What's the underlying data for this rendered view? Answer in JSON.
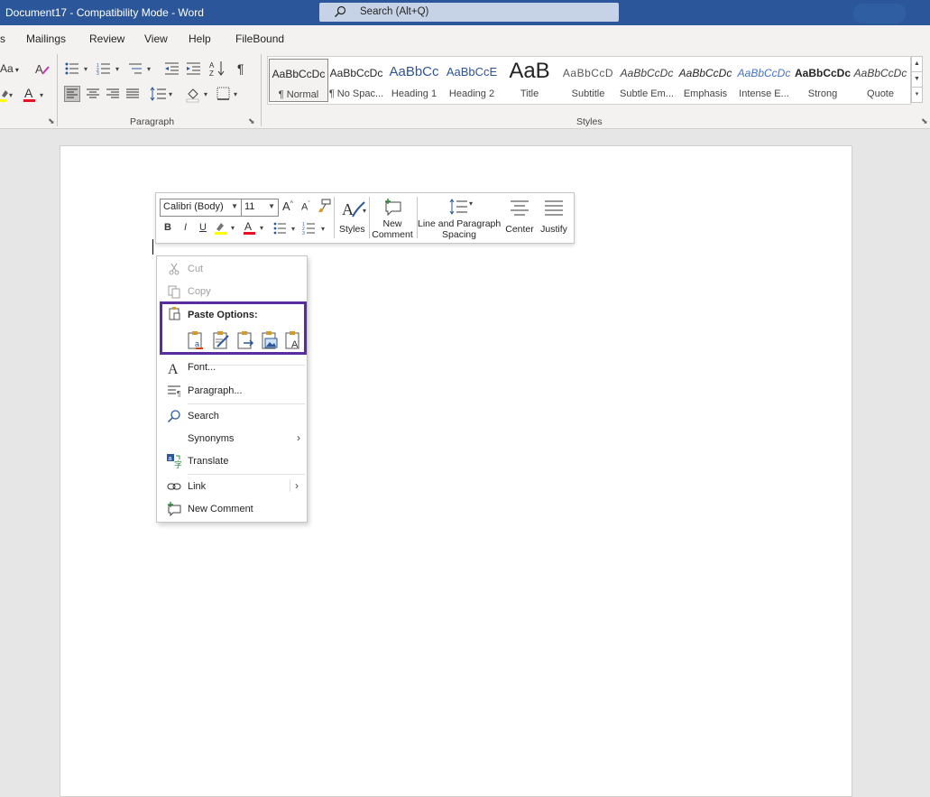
{
  "window": {
    "title": "Document17  -  Compatibility Mode  -  Word",
    "search_placeholder": "Search (Alt+Q)"
  },
  "tabs": [
    {
      "label": "s"
    },
    {
      "label": "Mailings"
    },
    {
      "label": "Review"
    },
    {
      "label": "View"
    },
    {
      "label": "Help"
    },
    {
      "label": "FileBound"
    }
  ],
  "ribbon": {
    "groups": {
      "paragraph": "Paragraph",
      "styles": "Styles"
    },
    "font_case": "Aa",
    "pilcrow": "¶"
  },
  "styles_gallery": [
    {
      "preview": "AaBbCcDc",
      "name": "¶ Normal",
      "selected": true
    },
    {
      "preview": "AaBbCcDc",
      "name": "¶ No Spac..."
    },
    {
      "preview": "AaBbCc",
      "name": "Heading 1"
    },
    {
      "preview": "AaBbCcE",
      "name": "Heading 2"
    },
    {
      "preview": "AaB",
      "name": "Title"
    },
    {
      "preview": "AaBbCcD",
      "name": "Subtitle"
    },
    {
      "preview": "AaBbCcDc",
      "name": "Subtle Em..."
    },
    {
      "preview": "AaBbCcDc",
      "name": "Emphasis"
    },
    {
      "preview": "AaBbCcDc",
      "name": "Intense E..."
    },
    {
      "preview": "AaBbCcDc",
      "name": "Strong"
    },
    {
      "preview": "AaBbCcDc",
      "name": "Quote"
    }
  ],
  "mini_toolbar": {
    "font_name": "Calibri (Body)",
    "font_size": "11",
    "grow": "A",
    "shrink": "A",
    "bold": "B",
    "italic": "I",
    "underline": "U",
    "font_color_letter": "A",
    "styles": "Styles",
    "new_comment_line1": "New",
    "new_comment_line2": "Comment",
    "spacing_line1": "Line and Paragraph",
    "spacing_line2": "Spacing",
    "center": "Center",
    "justify": "Justify"
  },
  "context_menu": {
    "cut": "Cut",
    "copy": "Copy",
    "paste_options": "Paste Options:",
    "font": "Font...",
    "paragraph": "Paragraph...",
    "search": "Search",
    "synonyms": "Synonyms",
    "translate": "Translate",
    "link": "Link",
    "new_comment": "New Comment"
  },
  "colors": {
    "title_bar": "#2b579a",
    "highlight_box": "#5a2ca0",
    "font_color_red": "#e81123",
    "highlight_yellow": "#ffff00"
  }
}
